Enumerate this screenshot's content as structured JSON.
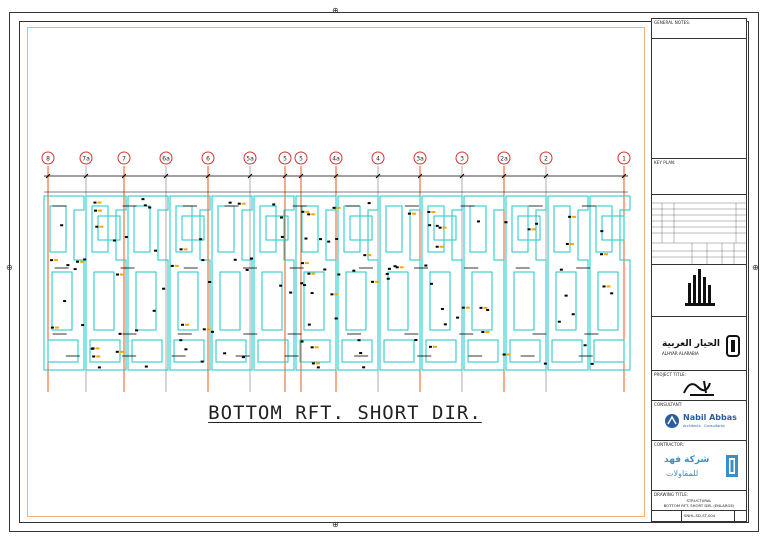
{
  "drawing": {
    "title": "BOTTOM RFT. SHORT DIR.",
    "grid_labels": [
      "8",
      "7a",
      "7",
      "6a",
      "6",
      "5a",
      "5",
      "5",
      "4a",
      "4",
      "3a",
      "3",
      "2a",
      "2",
      "1"
    ]
  },
  "title_block": {
    "general_notes": "GENERAL NOTES:",
    "key_plan": "KEY PLAN:",
    "project_title": "PROJECT TITLE:",
    "consultant": "CONSULTANT:",
    "contractor": "CONTRACTOR:",
    "drawing_title_label": "DRAWING TITLE:",
    "drawing_title_line1": "STRUCTURAL",
    "drawing_title_line2": "BOTTOM RFT. SHORT DIR.   (ENLARGE)",
    "drawing_no": "SNHL-SD-ST-004",
    "consultant_name": "Nabil Abbas",
    "consultant_sub": "Architects - Consultants",
    "owner_name": "الحيار العربية",
    "owner_name_en": "ALHYAR ALARABIA",
    "contractor_name": "شركة فهد",
    "contractor_sub": "للمقاولات"
  },
  "colors": {
    "grid_line": "#e8591a",
    "grid_bubble": "#d9332b",
    "wall": "#19c7c7",
    "rebar": "#000000",
    "frame": "#f2b07a",
    "highlight": "#ffa500"
  }
}
